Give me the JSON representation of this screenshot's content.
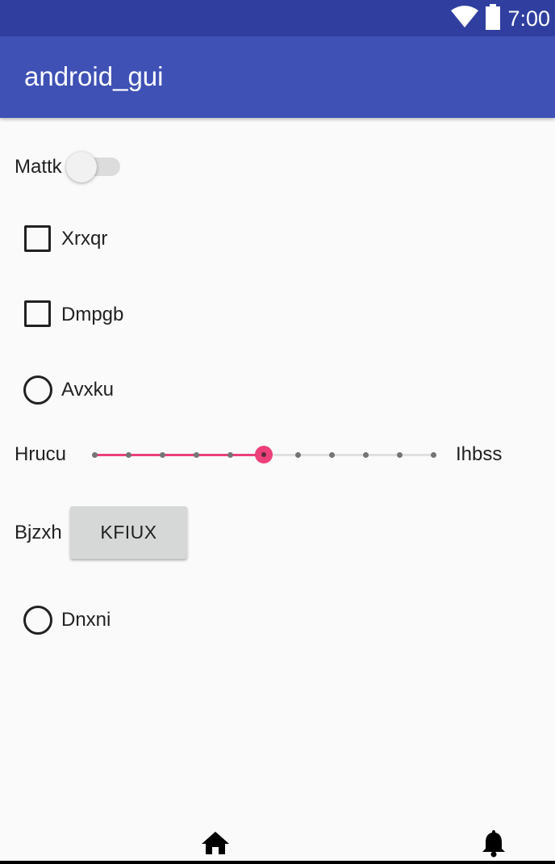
{
  "status_bar": {
    "time": "7:00",
    "icons": [
      "wifi-icon",
      "battery-icon"
    ]
  },
  "app_bar": {
    "title": "android_gui"
  },
  "switch": {
    "label": "Mattk",
    "checked": false
  },
  "checkboxes": [
    {
      "label": "Xrxqr",
      "checked": false
    },
    {
      "label": "Dmpgb",
      "checked": false
    }
  ],
  "radios": [
    {
      "label": "Avxku",
      "checked": false
    },
    {
      "label": "Dnxni",
      "checked": false
    }
  ],
  "seekbar": {
    "left_label": "Hrucu",
    "right_label": "Ihbss",
    "value": 5,
    "max": 10
  },
  "button_row": {
    "label": "Bjzxh",
    "button_label": "KFIUX"
  },
  "bottom_nav": {
    "icons": [
      "home-icon",
      "bell-icon"
    ]
  },
  "colors": {
    "status_bar": "#303f9f",
    "app_bar": "#3f51b5",
    "accent": "#ec407a",
    "background": "#fafafa"
  }
}
